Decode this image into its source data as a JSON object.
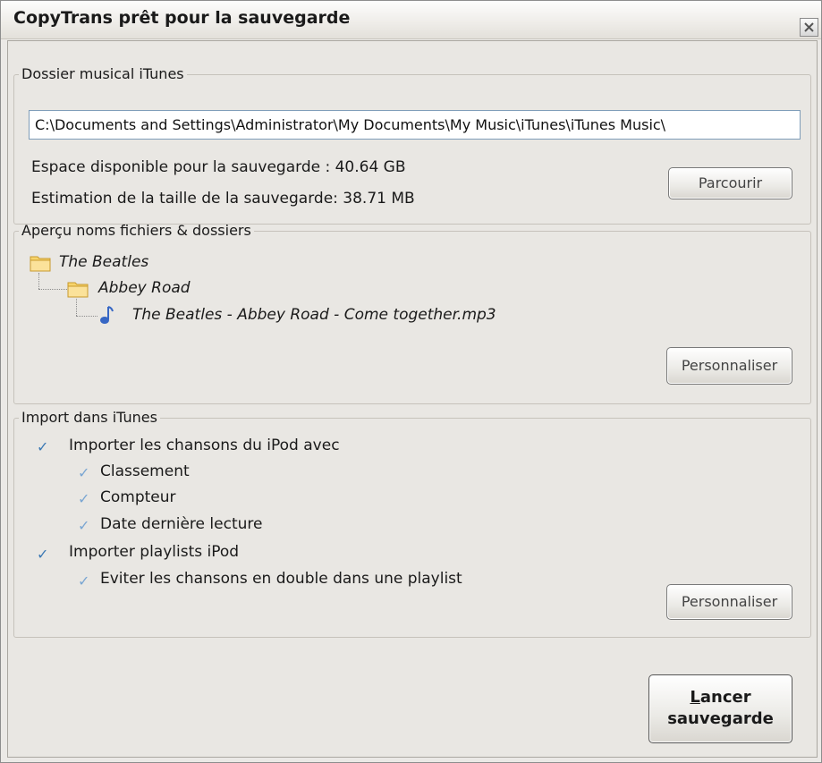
{
  "dialog": {
    "title": "CopyTrans prêt pour la sauvegarde"
  },
  "music_folder": {
    "legend": "Dossier musical iTunes",
    "path": "C:\\Documents and Settings\\Administrator\\My Documents\\My Music\\iTunes\\iTunes Music\\",
    "space_available": "Espace disponible pour la sauvegarde : 40.64 GB",
    "size_estimate": "Estimation de la taille de la sauvegarde: 38.71 MB",
    "browse_label": "Parcourir"
  },
  "preview": {
    "legend": "Aperçu noms fichiers & dossiers",
    "artist_folder": "The Beatles",
    "album_folder": "Abbey Road",
    "file_name": "The Beatles - Abbey Road - Come together.mp3",
    "customize_label": "Personnaliser"
  },
  "import": {
    "legend": "Import dans iTunes",
    "import_songs": "Importer les chansons du iPod avec",
    "rating": "Classement",
    "play_count": "Compteur",
    "last_played": "Date dernière lecture",
    "import_playlists": "Importer playlists iPod",
    "avoid_duplicates": "Eviter les chansons en double dans une playlist",
    "customize_label": "Personnaliser"
  },
  "start_backup": {
    "mnemonic": "L",
    "line1_rest": "ancer",
    "line2": "sauvegarde"
  }
}
